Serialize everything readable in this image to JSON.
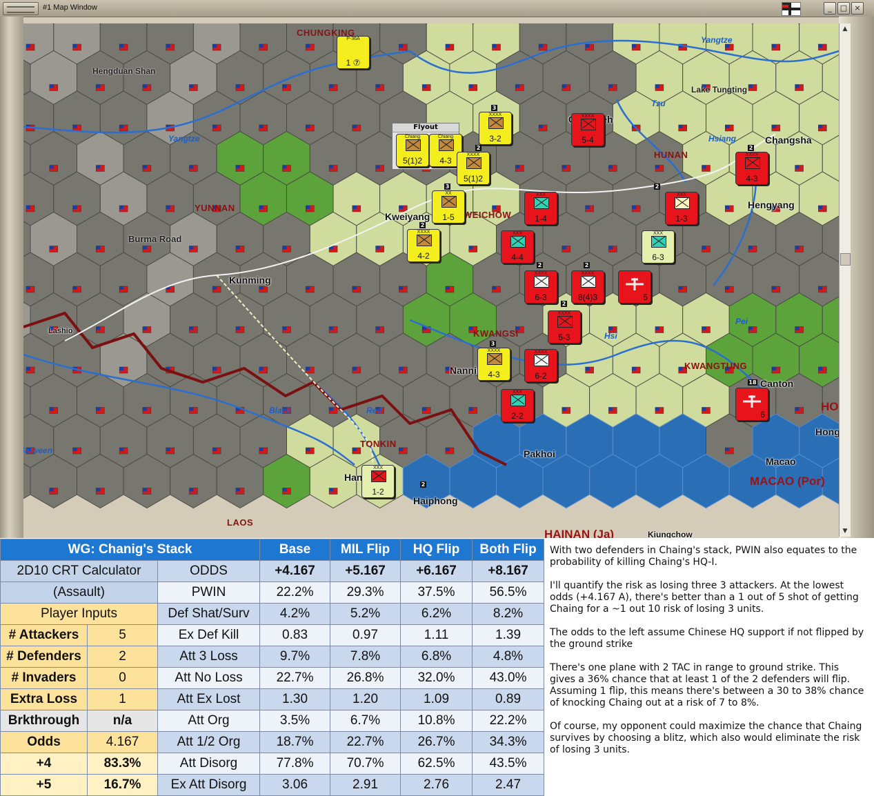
{
  "window": {
    "title": "#1 Map Window",
    "minimize_glyph": "_",
    "maximize_glyph": "□",
    "close_glyph": "×",
    "flag_icon": "german-war-flag-icon",
    "scroll_up_glyph": "▲",
    "scroll_down_glyph": "▼"
  },
  "map": {
    "cities": [
      "CHUNGKING",
      "Kweiyang",
      "Kunming",
      "Changsha",
      "Hengyang",
      "Lashio",
      "Nanning",
      "Hanoi",
      "Haiphong",
      "Pakhoi",
      "Macao",
      "Canton",
      "Hong Kong",
      "Kiungchow",
      "Changteh"
    ],
    "provinces": [
      "YUNNAN",
      "KWEICHOW",
      "HUNAN",
      "KWANGSI",
      "KWANGTUNG",
      "TONKIN",
      "LAOS"
    ],
    "rivers": [
      "Yangtze",
      "Yangtze",
      "Tzu",
      "Hsiang",
      "Hsi",
      "Pei",
      "Black",
      "Red",
      "Salween"
    ],
    "terrain": [
      "Hengduan Shan",
      "Burma Road",
      "Lake Tungting"
    ],
    "colonies": [
      "MACAO (Por)",
      "HAINAN (Ja)",
      "HONG"
    ],
    "flyout_title": "Flyout",
    "units": [
      {
        "side": "cn",
        "size": "P-36A",
        "value": "1 ⑦",
        "label": "Mohawk"
      },
      {
        "side": "cn",
        "size": "XXXX",
        "value": "3-2"
      },
      {
        "side": "cn",
        "size": "Chiang",
        "value": "5(1)2"
      },
      {
        "side": "cn",
        "size": "Chiang",
        "value": "4-3"
      },
      {
        "side": "cn",
        "size": "XXXX",
        "value": "5(1)2"
      },
      {
        "side": "cn",
        "size": "XX",
        "value": "1-5"
      },
      {
        "side": "cn",
        "size": "XXXX",
        "value": "4-2"
      },
      {
        "side": "cn",
        "size": "XXXX",
        "value": "4-3"
      },
      {
        "side": "gr",
        "size": "XXX",
        "value": "1-2"
      },
      {
        "side": "jp",
        "size": "XXXX",
        "value": "5-4"
      },
      {
        "side": "jp",
        "size": "XXXX",
        "value": "4-3"
      },
      {
        "side": "jp",
        "size": "XXX",
        "value": "1-4"
      },
      {
        "side": "jp",
        "size": "XXX",
        "value": "1-3"
      },
      {
        "side": "jp",
        "size": "XXX",
        "value": "4-4"
      },
      {
        "side": "gr",
        "size": "XXX",
        "value": "6-3"
      },
      {
        "side": "jp",
        "size": "XXXX",
        "value": "6-3"
      },
      {
        "side": "jp",
        "size": "XXXX",
        "value": "8(4)3"
      },
      {
        "side": "jp",
        "size": "",
        "value": "5"
      },
      {
        "side": "jp",
        "size": "XXXX",
        "value": "5-3"
      },
      {
        "side": "jp",
        "size": "XXXX",
        "value": "6-2"
      },
      {
        "side": "jp",
        "size": "XXX",
        "value": "2-2"
      },
      {
        "side": "jp",
        "size": "",
        "value": "6"
      }
    ],
    "stack_counts": [
      "3",
      "2",
      "2",
      "3",
      "2",
      "2",
      "2",
      "2",
      "2",
      "3",
      "18",
      "2"
    ]
  },
  "sheet": {
    "title": "WG: Chanig's Stack",
    "columns": [
      "Base",
      "MIL Flip",
      "HQ Flip",
      "Both Flip"
    ],
    "calc_title_1": "2D10 CRT Calculator",
    "calc_title_2": "(Assault)",
    "player_inputs": "Player Inputs",
    "inputs": [
      {
        "label": "# Attackers",
        "value": "5"
      },
      {
        "label": "# Defenders",
        "value": "2"
      },
      {
        "label": "# Invaders",
        "value": "0"
      },
      {
        "label": "Extra Loss",
        "value": "1"
      },
      {
        "label": "Brkthrough",
        "value": "n/a"
      },
      {
        "label": "Odds",
        "value": "4.167"
      },
      {
        "label": "+4",
        "value": "83.3%"
      },
      {
        "label": "+5",
        "value": "16.7%"
      }
    ],
    "rows": [
      {
        "label": "ODDS",
        "values": [
          "+4.167",
          "+5.167",
          "+6.167",
          "+8.167"
        ]
      },
      {
        "label": "PWIN",
        "values": [
          "22.2%",
          "29.3%",
          "37.5%",
          "56.5%"
        ]
      },
      {
        "label": "Def Shat/Surv",
        "values": [
          "4.2%",
          "5.2%",
          "6.2%",
          "8.2%"
        ]
      },
      {
        "label": "Ex Def Kill",
        "values": [
          "0.83",
          "0.97",
          "1.11",
          "1.39"
        ]
      },
      {
        "label": "Att 3 Loss",
        "values": [
          "9.7%",
          "7.8%",
          "6.8%",
          "4.8%"
        ]
      },
      {
        "label": "Att No Loss",
        "values": [
          "22.7%",
          "26.8%",
          "32.0%",
          "43.0%"
        ]
      },
      {
        "label": "Att Ex Lost",
        "values": [
          "1.30",
          "1.20",
          "1.09",
          "0.89"
        ]
      },
      {
        "label": "Att Org",
        "values": [
          "3.5%",
          "6.7%",
          "10.8%",
          "22.2%"
        ]
      },
      {
        "label": "Att 1/2 Org",
        "values": [
          "18.7%",
          "22.7%",
          "26.7%",
          "34.3%"
        ]
      },
      {
        "label": "Att Disorg",
        "values": [
          "77.8%",
          "70.7%",
          "62.5%",
          "43.5%"
        ]
      },
      {
        "label": "Ex Att Disorg",
        "values": [
          "3.06",
          "2.91",
          "2.76",
          "2.47"
        ]
      }
    ]
  },
  "notes": [
    "With two defenders in Chaing's stack, PWIN also equates to the probability of killing Chaing's HQ-I.",
    "I'll quantify the risk as losing three 3 attackers.  At the lowest odds (+4.167 A), there's better than a 1 out of 5 shot of getting Chaing for a ~1 out 10 risk of losing 3 units.",
    "The odds to the left assume Chinese HQ support if not flipped by the ground strike",
    "There's one plane with 2 TAC in range to ground strike. This gives a 36% chance that at least 1 of the 2 defenders will flip.  Assuming 1 flip, this means there's between a 30 to 38% chance of knocking Chaing out at a risk of 7 to 8%.",
    "Of course, my opponent could maximize the chance that Chaing survives by choosing a blitz, which also would eliminate the risk of losing 3 units."
  ],
  "colors": {
    "header_blue": "#1e78d2",
    "label_blue": "#c2d3ea",
    "input_gold": "#fde29b",
    "chinese_unit": "#f4ee1e",
    "japanese_unit": "#e8141c",
    "sea": "#1f5fa8"
  }
}
